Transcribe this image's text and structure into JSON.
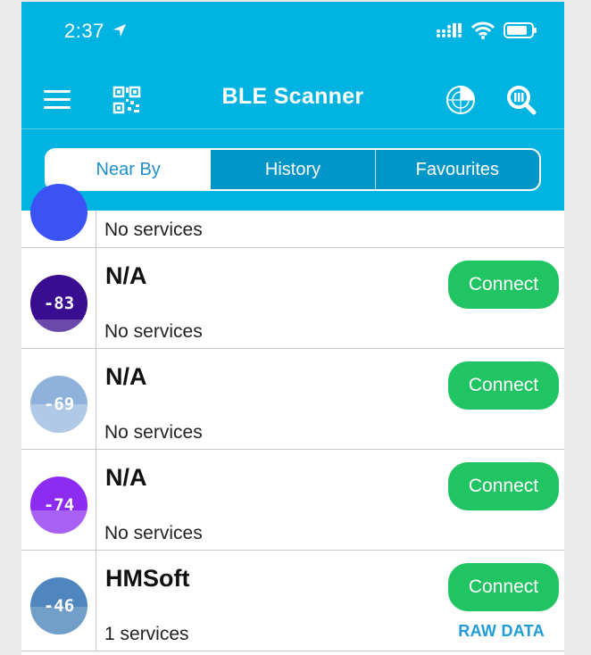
{
  "status_bar": {
    "time": "2:37"
  },
  "header": {
    "title": "BLE Scanner"
  },
  "tabs": [
    {
      "label": "Near By",
      "active": true
    },
    {
      "label": "History",
      "active": false
    },
    {
      "label": "Favourites",
      "active": false
    }
  ],
  "devices": [
    {
      "name": "",
      "rssi": "",
      "services": "No services",
      "color": "#3b53f5",
      "partial": true
    },
    {
      "name": "N/A",
      "rssi": "-83",
      "services": "No services",
      "color": "#3a0c8f",
      "connect": "Connect"
    },
    {
      "name": "N/A",
      "rssi": "-69",
      "services": "No services",
      "color": "#8fb2dc",
      "connect": "Connect"
    },
    {
      "name": "N/A",
      "rssi": "-74",
      "services": "No services",
      "color": "#8b2cf0",
      "connect": "Connect"
    },
    {
      "name": "HMSoft",
      "rssi": "-46",
      "services": "1 services",
      "color": "#4f86bd",
      "connect": "Connect",
      "raw_data": "RAW DATA"
    }
  ],
  "colors": {
    "header": "#00b3e0",
    "connect": "#21c463",
    "link": "#1e9cd7"
  }
}
